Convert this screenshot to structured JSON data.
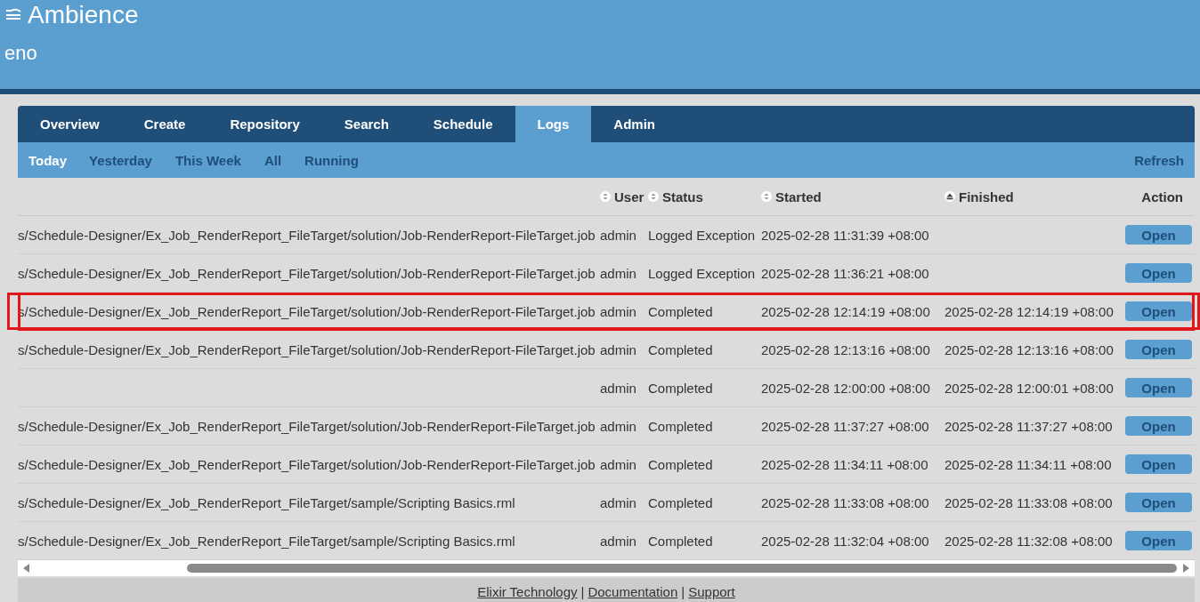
{
  "header": {
    "title": "Ambience",
    "user": "eno"
  },
  "tabs": [
    {
      "label": "Overview",
      "selected": false
    },
    {
      "label": "Create",
      "selected": false
    },
    {
      "label": "Repository",
      "selected": false
    },
    {
      "label": "Search",
      "selected": false
    },
    {
      "label": "Schedule",
      "selected": false
    },
    {
      "label": "Logs",
      "selected": true
    },
    {
      "label": "Admin",
      "selected": false
    }
  ],
  "filters": [
    {
      "label": "Today",
      "selected": true
    },
    {
      "label": "Yesterday",
      "selected": false
    },
    {
      "label": "This Week",
      "selected": false
    },
    {
      "label": "All",
      "selected": false
    },
    {
      "label": "Running",
      "selected": false
    }
  ],
  "refresh": "Refresh",
  "table": {
    "columns": [
      {
        "label": "User",
        "sorted": false
      },
      {
        "label": "Status",
        "sorted": false
      },
      {
        "label": "Started",
        "sorted": false
      },
      {
        "label": "Finished",
        "sorted": true
      }
    ],
    "action_header": "Action",
    "rows": [
      {
        "path": "s/Schedule-Designer/Ex_Job_RenderReport_FileTarget/solution/Job-RenderReport-FileTarget.job",
        "user": "admin",
        "status": "Logged Exception",
        "started": "2025-02-28 11:31:39 +08:00",
        "action": "Open",
        "highlighted": false
      },
      {
        "path": "s/Schedule-Designer/Ex_Job_RenderReport_FileTarget/solution/Job-RenderReport-FileTarget.job",
        "user": "admin",
        "status": "Logged Exception",
        "started": "2025-02-28 11:36:21 +08:00",
        "action": "Open",
        "highlighted": false
      },
      {
        "path": "s/Schedule-Designer/Ex_Job_RenderReport_FileTarget/solution/Job-RenderReport-FileTarget.job",
        "user": "admin",
        "status": "Completed",
        "started": "2025-02-28 12:14:19 +08:00",
        "finished": "2025-02-28 12:14:19 +08:00",
        "action": "Open",
        "highlighted": true
      },
      {
        "path": "s/Schedule-Designer/Ex_Job_RenderReport_FileTarget/solution/Job-RenderReport-FileTarget.job",
        "user": "admin",
        "status": "Completed",
        "started": "2025-02-28 12:13:16 +08:00",
        "finished": "2025-02-28 12:13:16 +08:00",
        "action": "Open",
        "highlighted": false
      },
      {
        "user": "admin",
        "status": "Completed",
        "started": "2025-02-28 12:00:00 +08:00",
        "finished": "2025-02-28 12:00:01 +08:00",
        "action": "Open",
        "highlighted": false
      },
      {
        "path": "s/Schedule-Designer/Ex_Job_RenderReport_FileTarget/solution/Job-RenderReport-FileTarget.job",
        "user": "admin",
        "status": "Completed",
        "started": "2025-02-28 11:37:27 +08:00",
        "finished": "2025-02-28 11:37:27 +08:00",
        "action": "Open",
        "highlighted": false
      },
      {
        "path": "s/Schedule-Designer/Ex_Job_RenderReport_FileTarget/solution/Job-RenderReport-FileTarget.job",
        "user": "admin",
        "status": "Completed",
        "started": "2025-02-28 11:34:11 +08:00",
        "finished": "2025-02-28 11:34:11 +08:00",
        "action": "Open",
        "highlighted": false
      },
      {
        "path": "s/Schedule-Designer/Ex_Job_RenderReport_FileTarget/sample/Scripting Basics.rml",
        "user": "admin",
        "status": "Completed",
        "started": "2025-02-28 11:33:08 +08:00",
        "finished": "2025-02-28 11:33:08 +08:00",
        "action": "Open",
        "highlighted": false
      },
      {
        "path": "s/Schedule-Designer/Ex_Job_RenderReport_FileTarget/sample/Scripting Basics.rml",
        "user": "admin",
        "status": "Completed",
        "started": "2025-02-28 11:32:04 +08:00",
        "finished": "2025-02-28 11:32:08 +08:00",
        "action": "Open",
        "highlighted": false
      }
    ]
  },
  "footer": {
    "links": [
      "Elixir Technology",
      "Documentation",
      "Support"
    ],
    "separator": "|"
  }
}
